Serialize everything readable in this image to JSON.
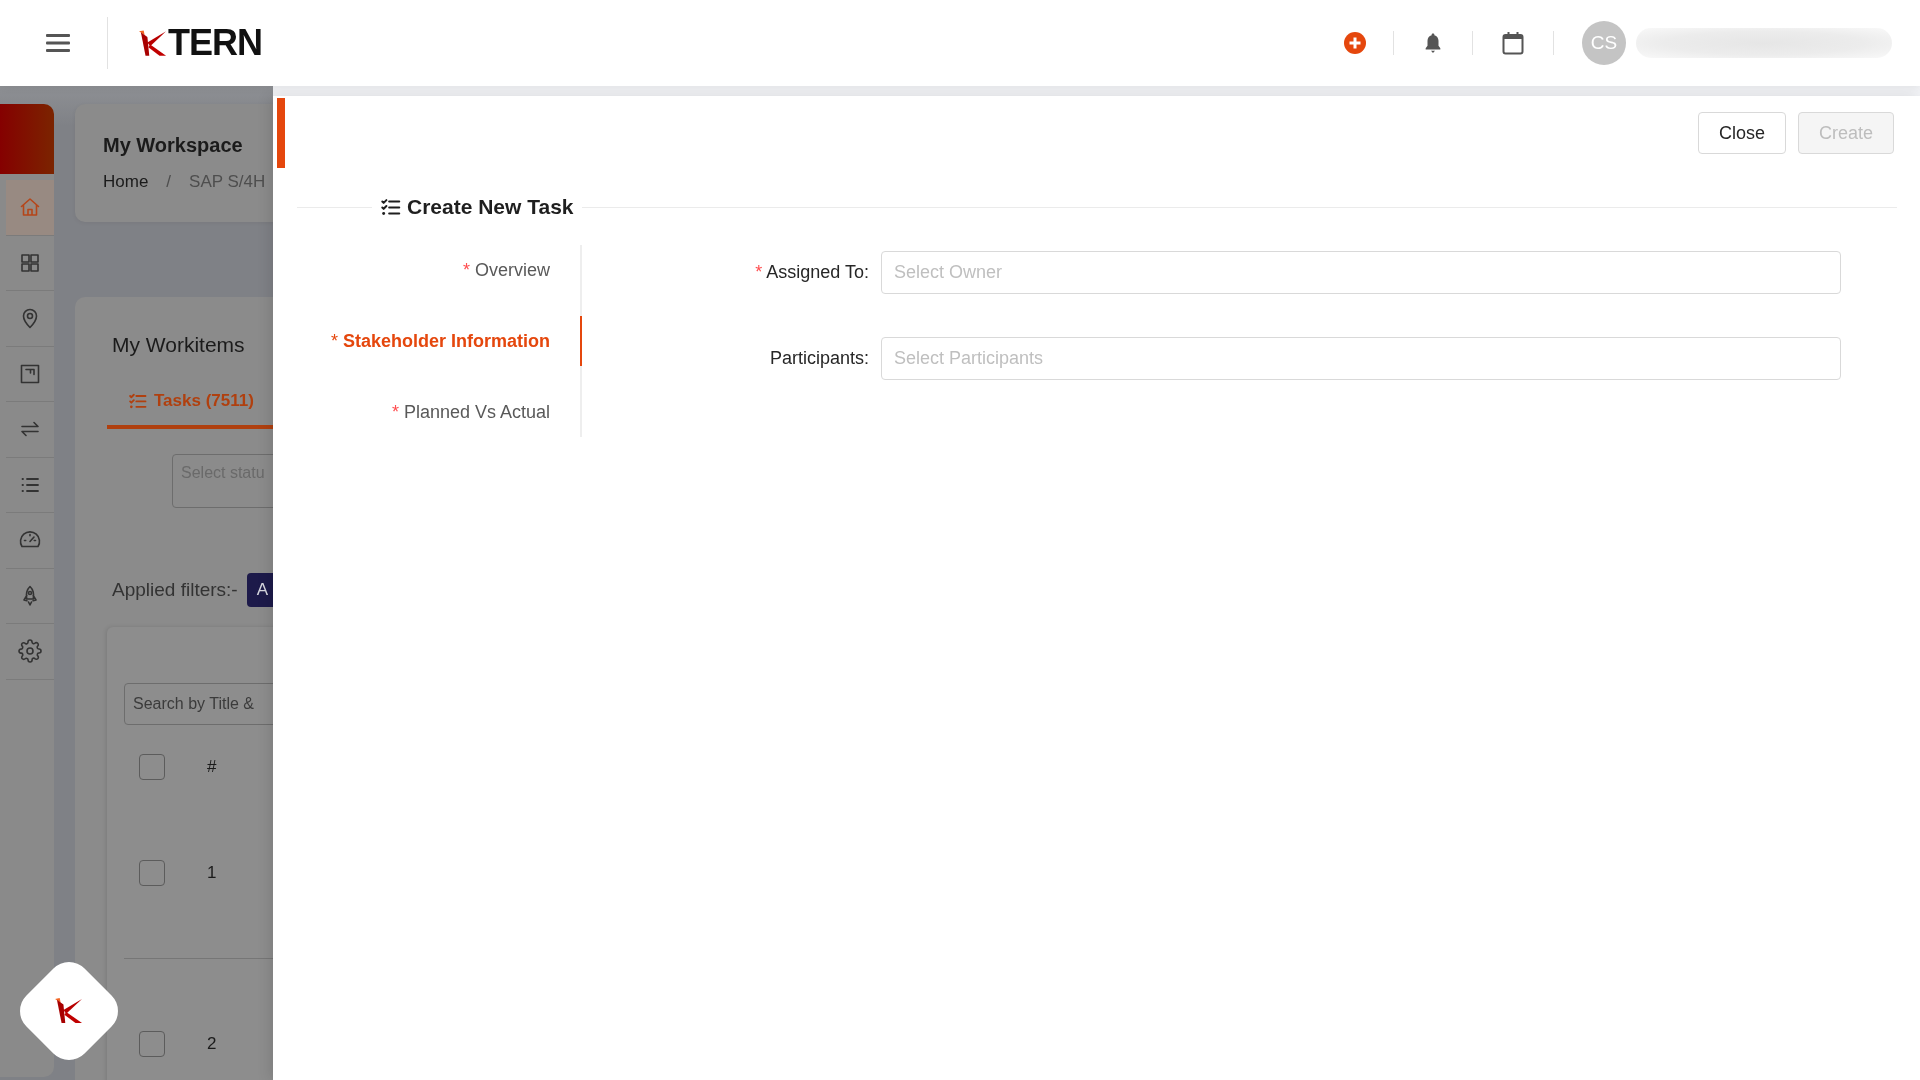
{
  "top_bar": {
    "logo_text": "TERN",
    "avatar_initials": "CS"
  },
  "sidebar": {
    "items": [
      {
        "kind": "home",
        "selected": true
      },
      {
        "kind": "grid",
        "selected": false
      },
      {
        "kind": "pin",
        "selected": false
      },
      {
        "kind": "board",
        "selected": false
      },
      {
        "kind": "arrows",
        "selected": false
      },
      {
        "kind": "list",
        "selected": false
      },
      {
        "kind": "gauge",
        "selected": false
      },
      {
        "kind": "rocket",
        "selected": false
      },
      {
        "kind": "gear",
        "selected": false
      }
    ]
  },
  "workspace": {
    "title": "My Workspace",
    "breadcrumb": [
      "Home",
      "SAP S/4H"
    ],
    "breadcrumb_separator": "/"
  },
  "workitems": {
    "title": "My Workitems",
    "tabs": [
      {
        "label": "Tasks (7511)",
        "selected": true
      }
    ],
    "status_select": {
      "placeholder": "Select statu"
    },
    "applied_filters_label": "Applied filters:-",
    "filter_tags": [
      "A"
    ],
    "search": {
      "placeholder": "Search by Title &"
    },
    "table": {
      "all_checked": false,
      "columns": [
        "#"
      ],
      "rows": [
        {
          "number": "1",
          "checked": false
        },
        {
          "number": "2",
          "checked": false
        }
      ]
    }
  },
  "drawer": {
    "buttons": [
      {
        "label": "Close",
        "disabled": false
      },
      {
        "label": "Create",
        "disabled": true
      }
    ],
    "title": "Create New Task",
    "steps": [
      {
        "mark": "*",
        "label": "Overview",
        "selected": false
      },
      {
        "mark": "*",
        "label": "Stakeholder Information",
        "selected": true
      },
      {
        "mark": "*",
        "label": "Planned Vs Actual",
        "selected": false
      }
    ],
    "fields": [
      {
        "mark": "*",
        "label": "Assigned To:",
        "placeholder": "Select Owner"
      },
      {
        "label": "Participants:",
        "placeholder": "Select Participants"
      }
    ]
  }
}
